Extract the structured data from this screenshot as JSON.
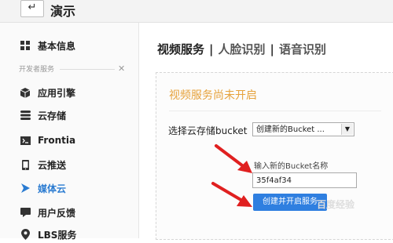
{
  "header": {
    "back_icon": "↵",
    "title": "演示"
  },
  "sidebar": {
    "items": [
      {
        "label": "基本信息",
        "icon": "grid-icon"
      },
      {
        "label": "应用引擎",
        "icon": "cube-icon"
      },
      {
        "label": "云存储",
        "icon": "layers-icon"
      },
      {
        "label": "Frontia",
        "icon": "terminal-icon"
      },
      {
        "label": "云推送",
        "icon": "phone-icon"
      },
      {
        "label": "媒体云",
        "icon": "play-icon"
      },
      {
        "label": "用户反馈",
        "icon": "chat-icon"
      },
      {
        "label": "LBS服务",
        "icon": "location-pin-icon"
      }
    ],
    "section_label": "开发者服务",
    "active_item": "媒体云"
  },
  "tabs": [
    {
      "label": "视频服务",
      "active": true
    },
    {
      "label": "人脸识别",
      "active": false
    },
    {
      "label": "语音识别",
      "active": false
    }
  ],
  "tab_separator": "|",
  "panel": {
    "title": "视频服务尚未开启",
    "select_label": "选择云存储bucket",
    "select_value": "创建新的Bucket ...",
    "input_label": "输入新的Bucket名称",
    "input_value": "35f4af34",
    "button_label": "创建并开启服务"
  },
  "watermark": "百度经验",
  "colors": {
    "accent": "#2f7fe0",
    "panel_title": "#e6a23c",
    "arrow": "#e02020"
  }
}
